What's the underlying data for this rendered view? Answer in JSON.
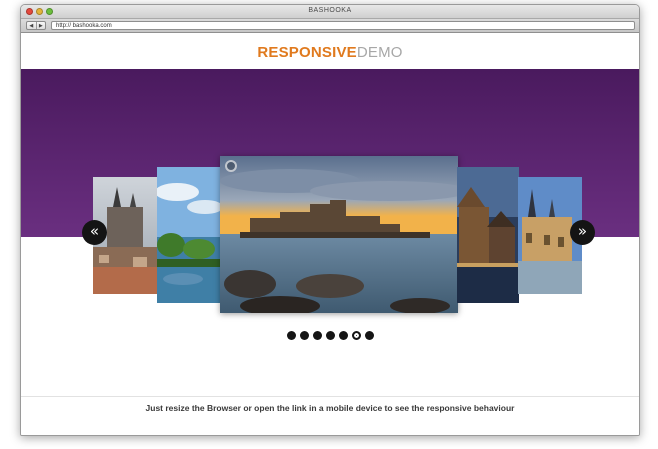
{
  "window": {
    "title": "BASHOOKA",
    "back_glyph": "◀",
    "forward_glyph": "▶"
  },
  "address_bar": {
    "url": "http:// bashooka.com"
  },
  "logo": {
    "part1": "RESPONSIVE",
    "part2": "DEMO",
    "accent_color": "#e07a1e",
    "muted_color": "#a7a7a7"
  },
  "band_color": "#56216d",
  "carousel": {
    "prev_glyph": "«",
    "next_glyph": "»",
    "slides": [
      {
        "name": "prague-towers"
      },
      {
        "name": "lake-trees"
      },
      {
        "name": "sea-fortress"
      },
      {
        "name": "lucerne-bridge"
      },
      {
        "name": "chateau-spires"
      }
    ],
    "active_slide": 3,
    "dot_count": 7,
    "active_dot": 6
  },
  "footer": {
    "text": "Just resize the Browser or open the link in a mobile device to see the responsive behaviour"
  }
}
